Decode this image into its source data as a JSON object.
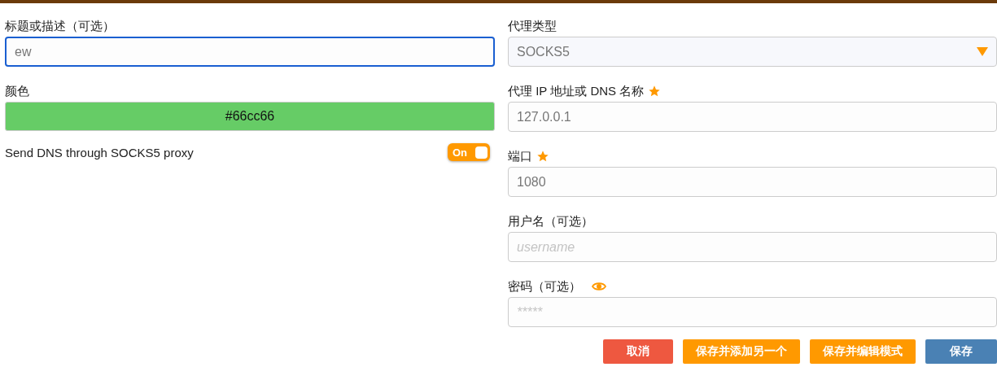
{
  "left": {
    "title_field": {
      "label": "标题或描述（可选）",
      "value": "ew",
      "focused": true
    },
    "color_field": {
      "label": "颜色",
      "value": "#66cc66",
      "color": "#66cc66"
    },
    "dns_toggle": {
      "label": "Send DNS through SOCKS5 proxy",
      "on": true,
      "state_text": "On"
    }
  },
  "right": {
    "fields": [
      {
        "kind": "select",
        "label": "代理类型",
        "value": "SOCKS5",
        "required": false
      },
      {
        "kind": "text",
        "label": "代理 IP 地址或 DNS 名称",
        "value": "127.0.0.1",
        "required": true
      },
      {
        "kind": "text",
        "label": "端口",
        "value": "1080",
        "required": true
      },
      {
        "kind": "text",
        "label": "用户名（可选）",
        "placeholder": "username",
        "required": false
      },
      {
        "kind": "password",
        "label": "密码（可选）",
        "placeholder": "*****",
        "required": false
      }
    ]
  },
  "buttons": [
    {
      "kind": "cancel",
      "label": "取消"
    },
    {
      "kind": "secondary",
      "label": "保存并添加另一个"
    },
    {
      "kind": "secondary",
      "label": "保存并编辑模式"
    },
    {
      "kind": "primary",
      "label": "保存"
    }
  ]
}
